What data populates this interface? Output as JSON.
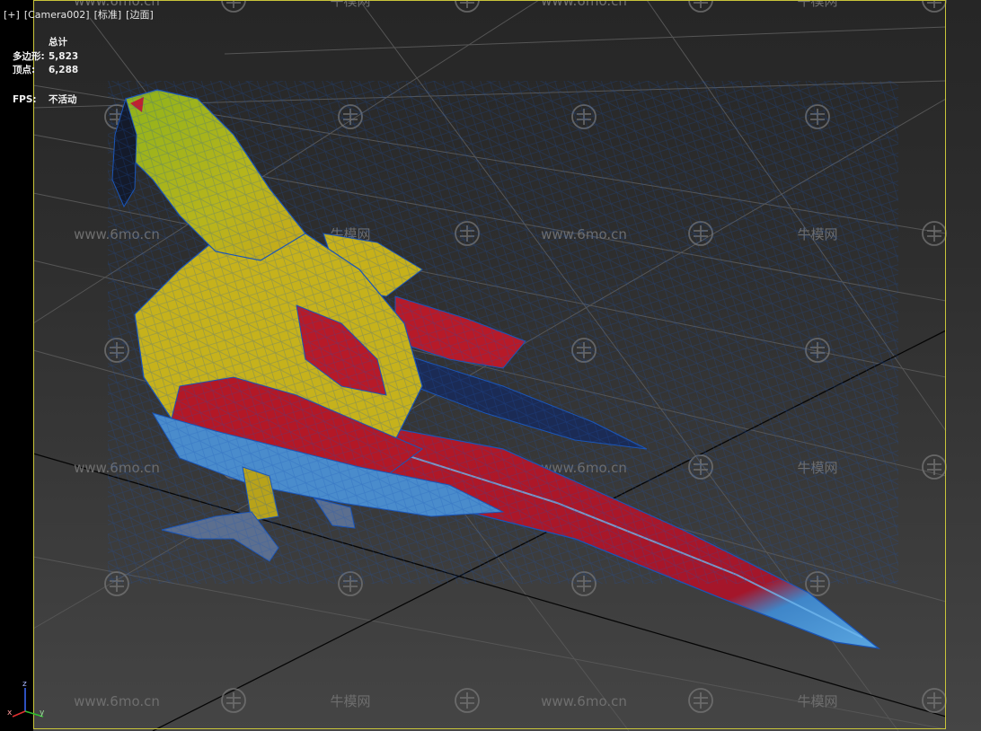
{
  "viewport": {
    "labels": [
      "[+]",
      "[Camera002]",
      "[标准]",
      "[边面]"
    ]
  },
  "stats": {
    "total_label": "总计",
    "polys_label": "多边形:",
    "polys_value": "5,823",
    "verts_label": "顶点:",
    "verts_value": "6,288",
    "fps_label": "FPS:",
    "fps_value": "不活动"
  },
  "watermark": {
    "url_text": "www.6mo.cn",
    "brand_text": "牛模网"
  },
  "axis": {
    "z": "z",
    "y": "y",
    "x": "x"
  },
  "colors": {
    "frame": "#c9c53a",
    "wire": "#1a55b8",
    "parrot_green": "#7ea817",
    "parrot_yellow": "#c8b21a",
    "parrot_red": "#b31826",
    "parrot_blue": "#3f86c9"
  }
}
